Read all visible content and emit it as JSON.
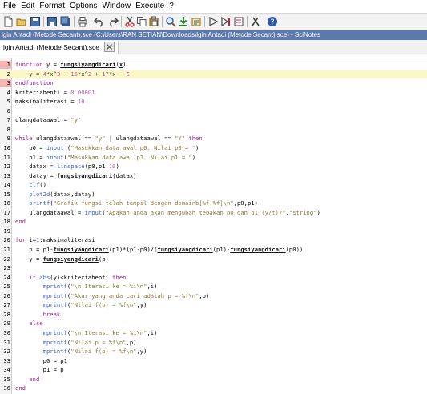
{
  "menu": [
    "File",
    "Edit",
    "Format",
    "Options",
    "Window",
    "Execute",
    "?"
  ],
  "title": "lgin Antadi (Metode Secant).sce (C:\\Users\\RAN SETIAN\\Downloads\\lgin Antadi (Metode Secant).sce) - SciNotes",
  "tab_label": "lgin Antadi (Metode Secant).sce",
  "line_numbers": [
    "1",
    "2",
    "3",
    "4",
    "5",
    "6",
    "7",
    "8",
    "9",
    "10",
    "11",
    "12",
    "13",
    "14",
    "15",
    "16",
    "17",
    "18",
    "19",
    "20",
    "21",
    "22",
    "23",
    "24",
    "25",
    "26",
    "27",
    "28",
    "29",
    "30",
    "31",
    "32",
    "33",
    "34",
    "35",
    "36"
  ],
  "colors": {
    "keyword": "#a0219c",
    "string": "#8c7a3e",
    "builtin": "#3b63c7",
    "breakpoint": "#f6b4b4",
    "title_bg": "#5b79ad"
  },
  "icons": [
    "new-file-icon",
    "open-file-icon",
    "save-icon",
    "save-as-icon",
    "print-icon",
    "undo-icon",
    "redo-icon",
    "cut-icon",
    "copy-icon",
    "paste-icon",
    "find-icon",
    "execute-icon",
    "load-icon",
    "run-icon",
    "step-icon",
    "debug-icon",
    "tools-icon",
    "help-icon"
  ],
  "code_lines": [
    [
      [
        "kw",
        "function "
      ],
      [
        "",
        "y = "
      ],
      [
        "udf",
        "fungsiyangdicari"
      ],
      [
        "",
        "("
      ],
      [
        "udf",
        "x"
      ],
      [
        "",
        ")"
      ]
    ],
    [
      [
        "dim",
        "    y = "
      ],
      [
        "num",
        "4"
      ],
      [
        "dim",
        "*x^"
      ],
      [
        "num",
        "3"
      ],
      [
        "dim",
        " - "
      ],
      [
        "num",
        "15"
      ],
      [
        "dim",
        "*x^"
      ],
      [
        "num",
        "2"
      ],
      [
        "dim",
        " + "
      ],
      [
        "num",
        "17"
      ],
      [
        "dim",
        "*x - "
      ],
      [
        "num",
        "6"
      ]
    ],
    [
      [
        "kw",
        "endfunction"
      ]
    ],
    [
      [
        "",
        "kriteriahenti = "
      ],
      [
        "num",
        "0.00001"
      ]
    ],
    [
      [
        "",
        "maksimaliterasi = "
      ],
      [
        "num",
        "10"
      ]
    ],
    [
      [
        "",
        ""
      ]
    ],
    [
      [
        "",
        "ulangdataawal = "
      ],
      [
        "str",
        "\"y\""
      ]
    ],
    [
      [
        "",
        ""
      ]
    ],
    [
      [
        "kw",
        "while "
      ],
      [
        "",
        "ulangdataawal == "
      ],
      [
        "str",
        "\"y\""
      ],
      [
        "",
        " | ulangdataawal == "
      ],
      [
        "str",
        "\"Y\""
      ],
      [
        "kw",
        " then"
      ]
    ],
    [
      [
        "",
        "    p0 = "
      ],
      [
        "fn",
        "input"
      ],
      [
        "",
        "",
        " "
      ],
      [
        "",
        "("
      ],
      [
        "str",
        "\"Masukkan data awal p0. Nilai p0 = \""
      ],
      [
        "",
        ")"
      ]
    ],
    [
      [
        "",
        "    p1 = "
      ],
      [
        "fn",
        "input"
      ],
      [
        "",
        "("
      ],
      [
        "str",
        "\"Masukkan data awal p1. Nilai p1 = \""
      ],
      [
        "",
        ")"
      ]
    ],
    [
      [
        "",
        "    datax = "
      ],
      [
        "fn",
        "linspace"
      ],
      [
        "",
        "(p0,p1,"
      ],
      [
        "num",
        "10"
      ],
      [
        "",
        ")"
      ]
    ],
    [
      [
        "",
        "    datay = "
      ],
      [
        "udf",
        "fungsiyangdicari"
      ],
      [
        "",
        "(datax)"
      ]
    ],
    [
      [
        "fn",
        "    clf"
      ],
      [
        "",
        "()"
      ]
    ],
    [
      [
        "fn",
        "    plot2d"
      ],
      [
        "",
        "(datax,datay)"
      ]
    ],
    [
      [
        "fn",
        "    printf"
      ],
      [
        "",
        "("
      ],
      [
        "str",
        "\"Grafik fungsi telah tampil dengan domainb[%f,%f]\\n\""
      ],
      [
        "",
        ",p0,p1)"
      ]
    ],
    [
      [
        "",
        "    ulangdataawal = "
      ],
      [
        "fn",
        "input"
      ],
      [
        "",
        "("
      ],
      [
        "str",
        "\"Apakah anda akan mengubah tebakan p0 dan p1 (y/t)?\""
      ],
      [
        "",
        ","
      ],
      [
        "str",
        "\"string\""
      ],
      [
        "",
        ")"
      ]
    ],
    [
      [
        "kw",
        "end"
      ]
    ],
    [
      [
        "",
        ""
      ]
    ],
    [
      [
        "kw",
        "for "
      ],
      [
        "",
        "i="
      ],
      [
        "num",
        "1"
      ],
      [
        "",
        ":maksimaliterasi"
      ]
    ],
    [
      [
        "",
        "    p = p1-"
      ],
      [
        "udf",
        "fungsiyangdicari"
      ],
      [
        "",
        "(p1)*(p1-p0)/("
      ],
      [
        "udf",
        "fungsiyangdicari"
      ],
      [
        "",
        "(p1)-"
      ],
      [
        "udf",
        "fungsiyangdicari"
      ],
      [
        "",
        "(p0))"
      ]
    ],
    [
      [
        "",
        "    y = "
      ],
      [
        "udf",
        "fungsiyangdicari"
      ],
      [
        "",
        "(p)"
      ]
    ],
    [
      [
        "",
        ""
      ]
    ],
    [
      [
        "kw",
        "    if "
      ],
      [
        "fn",
        "abs"
      ],
      [
        "",
        "(y)<kriteriahenti "
      ],
      [
        "kw",
        "then"
      ]
    ],
    [
      [
        "fn",
        "        mprintf"
      ],
      [
        "",
        "("
      ],
      [
        "str",
        "\"\\n Iterasi ke = %i\\n\""
      ],
      [
        "",
        ",i)"
      ]
    ],
    [
      [
        "fn",
        "        mprintf"
      ],
      [
        "",
        "("
      ],
      [
        "str",
        "\"Akar yang anda cari adalah p = %f\\n\""
      ],
      [
        "",
        ",p)"
      ]
    ],
    [
      [
        "fn",
        "        mprintf"
      ],
      [
        "",
        "("
      ],
      [
        "str",
        "\"Nilai f(p) = %f\\n\""
      ],
      [
        "",
        ",y)"
      ]
    ],
    [
      [
        "kw",
        "        break"
      ]
    ],
    [
      [
        "kw",
        "    else"
      ]
    ],
    [
      [
        "fn",
        "        mprintf"
      ],
      [
        "",
        "("
      ],
      [
        "str",
        "\"\\n Iterasi ke = %i\\n\""
      ],
      [
        "",
        ",i)"
      ]
    ],
    [
      [
        "fn",
        "        mprintf"
      ],
      [
        "",
        "("
      ],
      [
        "str",
        "\"Nilai p = %f\\n\""
      ],
      [
        "",
        ",p)"
      ]
    ],
    [
      [
        "fn",
        "        mprintf"
      ],
      [
        "",
        "("
      ],
      [
        "str",
        "\"Nilai f(p) = %f\\n\""
      ],
      [
        "",
        ",y)"
      ]
    ],
    [
      [
        "",
        "        p0 = p1"
      ]
    ],
    [
      [
        "",
        "        p1 = p"
      ]
    ],
    [
      [
        "kw",
        "    end"
      ]
    ],
    [
      [
        "kw",
        "end"
      ]
    ]
  ]
}
